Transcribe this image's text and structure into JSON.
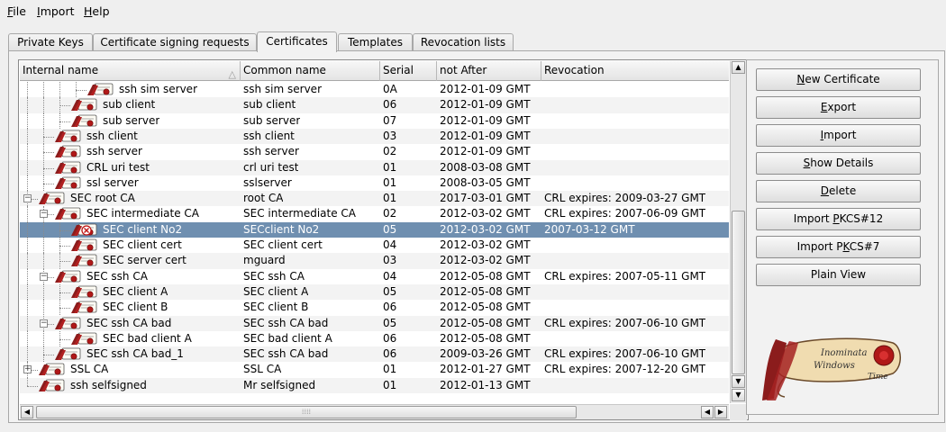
{
  "menu": [
    {
      "label": "File",
      "accel": "F",
      "rest": "ile"
    },
    {
      "label": "Import",
      "accel": "I",
      "rest": "mport"
    },
    {
      "label": "Help",
      "accel": "H",
      "rest": "elp"
    }
  ],
  "tabs": [
    "Private Keys",
    "Certificate signing requests",
    "Certificates",
    "Templates",
    "Revocation lists"
  ],
  "active_tab": "Certificates",
  "columns": [
    "Internal name",
    "Common name",
    "Serial",
    "not After",
    "Revocation"
  ],
  "rows": [
    {
      "name": "ssh sim server",
      "cn": "ssh sim server",
      "serial": "0A",
      "after": "2012-01-09 GMT",
      "rev": ""
    },
    {
      "name": "sub client",
      "cn": "sub client",
      "serial": "06",
      "after": "2012-01-09 GMT",
      "rev": ""
    },
    {
      "name": "sub server",
      "cn": "sub server",
      "serial": "07",
      "after": "2012-01-09 GMT",
      "rev": ""
    },
    {
      "name": "ssh client",
      "cn": "ssh client",
      "serial": "03",
      "after": "2012-01-09 GMT",
      "rev": ""
    },
    {
      "name": "ssh server",
      "cn": "ssh server",
      "serial": "02",
      "after": "2012-01-09 GMT",
      "rev": ""
    },
    {
      "name": "CRL uri test",
      "cn": "crl uri test",
      "serial": "01",
      "after": "2008-03-08 GMT",
      "rev": ""
    },
    {
      "name": "ssl server",
      "cn": "sslserver",
      "serial": "01",
      "after": "2008-03-05 GMT",
      "rev": ""
    },
    {
      "name": "SEC root CA",
      "cn": "root CA",
      "serial": "01",
      "after": "2017-03-01 GMT",
      "rev": "CRL expires: 2009-03-27 GMT"
    },
    {
      "name": "SEC intermediate CA",
      "cn": "SEC intermediate CA",
      "serial": "02",
      "after": "2012-03-02 GMT",
      "rev": "CRL expires: 2007-06-09 GMT"
    },
    {
      "name": "SEC client No2",
      "cn": "SECclient No2",
      "serial": "05",
      "after": "2012-03-02 GMT",
      "rev": "2007-03-12 GMT"
    },
    {
      "name": "SEC client cert",
      "cn": "SEC client cert",
      "serial": "04",
      "after": "2012-03-02 GMT",
      "rev": ""
    },
    {
      "name": "SEC server cert",
      "cn": "mguard",
      "serial": "03",
      "after": "2012-03-02 GMT",
      "rev": ""
    },
    {
      "name": "SEC ssh CA",
      "cn": "SEC ssh CA",
      "serial": "04",
      "after": "2012-05-08 GMT",
      "rev": "CRL expires: 2007-05-11 GMT"
    },
    {
      "name": "SEC client A",
      "cn": "SEC client A",
      "serial": "05",
      "after": "2012-05-08 GMT",
      "rev": ""
    },
    {
      "name": "SEC client B",
      "cn": "SEC client B",
      "serial": "06",
      "after": "2012-05-08 GMT",
      "rev": ""
    },
    {
      "name": "SEC ssh CA bad",
      "cn": "SEC ssh CA bad",
      "serial": "05",
      "after": "2012-05-08 GMT",
      "rev": "CRL expires: 2007-06-10 GMT"
    },
    {
      "name": "SEC bad client A",
      "cn": "SEC bad client A",
      "serial": "06",
      "after": "2012-05-08 GMT",
      "rev": ""
    },
    {
      "name": "SEC ssh CA bad_1",
      "cn": "SEC ssh CA bad",
      "serial": "06",
      "after": "2009-03-26 GMT",
      "rev": "CRL expires: 2007-06-10 GMT"
    },
    {
      "name": "SSL CA",
      "cn": "SSL CA",
      "serial": "01",
      "after": "2012-01-27 GMT",
      "rev": "CRL expires: 2007-12-20 GMT"
    },
    {
      "name": "ssh selfsigned",
      "cn": "Mr selfsigned",
      "serial": "01",
      "after": "2012-01-13 GMT",
      "rev": ""
    }
  ],
  "selected_row": "SEC client No2",
  "buttons": [
    {
      "label": "New Certificate",
      "accel": "N",
      "pre": "",
      "rest": "ew Certificate"
    },
    {
      "label": "Export",
      "accel": "E",
      "pre": "",
      "rest": "xport"
    },
    {
      "label": "Import",
      "accel": "I",
      "pre": "",
      "rest": "mport"
    },
    {
      "label": "Show Details",
      "accel": "S",
      "pre": "",
      "rest": "how Details"
    },
    {
      "label": "Delete",
      "accel": "D",
      "pre": "",
      "rest": "elete"
    },
    {
      "label": "Import PKCS#12",
      "accel": "P",
      "pre": "Import ",
      "rest": "KCS#12"
    },
    {
      "label": "Import PKCS#7",
      "accel": "K",
      "pre": "Import P",
      "rest": "CS#7"
    },
    {
      "label": "Plain View",
      "accel": "",
      "pre": "Plain View",
      "rest": ""
    }
  ],
  "logo": {
    "line1": "Inominata",
    "line2": "Windows",
    "line3": "Time"
  },
  "colors": {
    "selection": "#6f8fb0",
    "ribbon": "#8b1c1c",
    "scroll_paper": "#f0dcb0"
  }
}
